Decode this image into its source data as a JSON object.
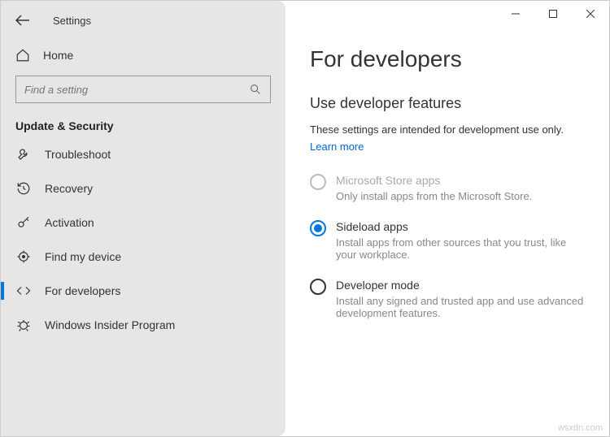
{
  "window": {
    "title": "Settings"
  },
  "sidebar": {
    "home": "Home",
    "search_placeholder": "Find a setting",
    "section": "Update & Security",
    "items": [
      {
        "label": "Troubleshoot"
      },
      {
        "label": "Recovery"
      },
      {
        "label": "Activation"
      },
      {
        "label": "Find my device"
      },
      {
        "label": "For developers"
      },
      {
        "label": "Windows Insider Program"
      }
    ]
  },
  "main": {
    "title": "For developers",
    "heading": "Use developer features",
    "description": "These settings are intended for development use only.",
    "link": "Learn more",
    "options": [
      {
        "label": "Microsoft Store apps",
        "sub": "Only install apps from the Microsoft Store."
      },
      {
        "label": "Sideload apps",
        "sub": "Install apps from other sources that you trust, like your workplace."
      },
      {
        "label": "Developer mode",
        "sub": "Install any signed and trusted app and use advanced development features."
      }
    ]
  },
  "watermark": "wsxdn.com"
}
